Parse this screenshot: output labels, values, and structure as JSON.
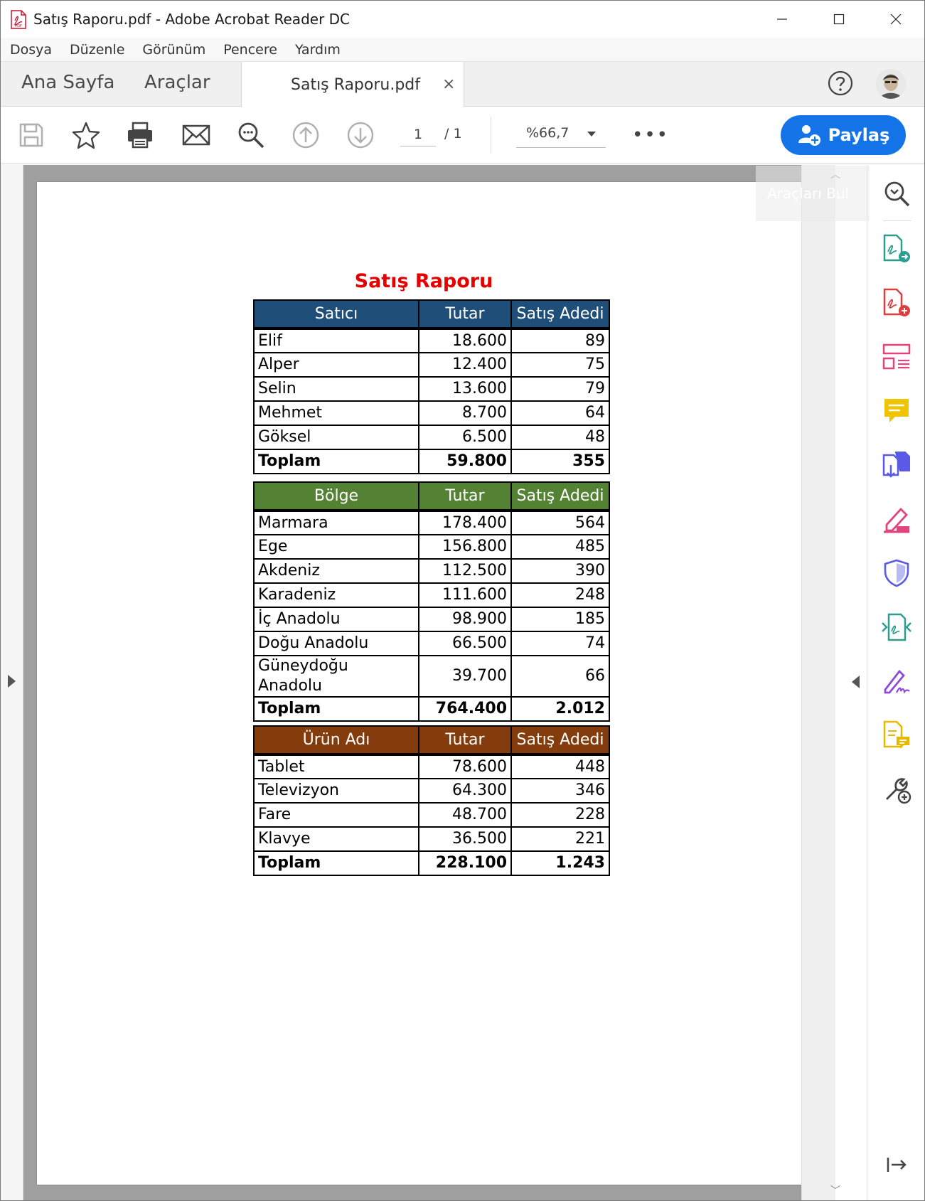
{
  "window": {
    "title": "Satış Raporu.pdf - Adobe Acrobat Reader DC",
    "app_icon": "pdf-file-icon",
    "app_icon_label": "PDF"
  },
  "menu": [
    "Dosya",
    "Düzenle",
    "Görünüm",
    "Pencere",
    "Yardım"
  ],
  "tabs": {
    "home": "Ana Sayfa",
    "tools": "Araçlar",
    "document": "Satış Raporu.pdf",
    "close_symbol": "×"
  },
  "toolbar": {
    "current_page": "1",
    "page_total": "/  1",
    "zoom": "%66,7",
    "more": "•••",
    "share_label": "Paylaş",
    "share_color": "#1473e6"
  },
  "right_pane": {
    "find_tools": "Araçları Bul"
  },
  "report": {
    "title": "Satış Raporu",
    "title_color": "#e60000",
    "tables": [
      {
        "header_color": "#1f4e79",
        "headers": [
          "Satıcı",
          "Tutar",
          "Satış Adedi"
        ],
        "rows": [
          [
            "Elif",
            "18.600",
            "89"
          ],
          [
            "Alper",
            "12.400",
            "75"
          ],
          [
            "Selin",
            "13.600",
            "79"
          ],
          [
            "Mehmet",
            "8.700",
            "64"
          ],
          [
            "Göksel",
            "6.500",
            "48"
          ]
        ],
        "total": [
          "Toplam",
          "59.800",
          "355"
        ]
      },
      {
        "header_color": "#548235",
        "headers": [
          "Bölge",
          "Tutar",
          "Satış Adedi"
        ],
        "rows": [
          [
            "Marmara",
            "178.400",
            "564"
          ],
          [
            "Ege",
            "156.800",
            "485"
          ],
          [
            "Akdeniz",
            "112.500",
            "390"
          ],
          [
            "Karadeniz",
            "111.600",
            "248"
          ],
          [
            "İç Anadolu",
            "98.900",
            "185"
          ],
          [
            "Doğu Anadolu",
            "66.500",
            "74"
          ],
          [
            "Güneydoğu Anadolu",
            "39.700",
            "66"
          ]
        ],
        "total": [
          "Toplam",
          "764.400",
          "2.012"
        ]
      },
      {
        "header_color": "#843c0c",
        "headers": [
          "Ürün Adı",
          "Tutar",
          "Satış Adedi"
        ],
        "rows": [
          [
            "Tablet",
            "78.600",
            "448"
          ],
          [
            "Televizyon",
            "64.300",
            "346"
          ],
          [
            "Fare",
            "48.700",
            "228"
          ],
          [
            "Klavye",
            "36.500",
            "221"
          ]
        ],
        "total": [
          "Toplam",
          "228.100",
          "1.243"
        ]
      }
    ]
  }
}
